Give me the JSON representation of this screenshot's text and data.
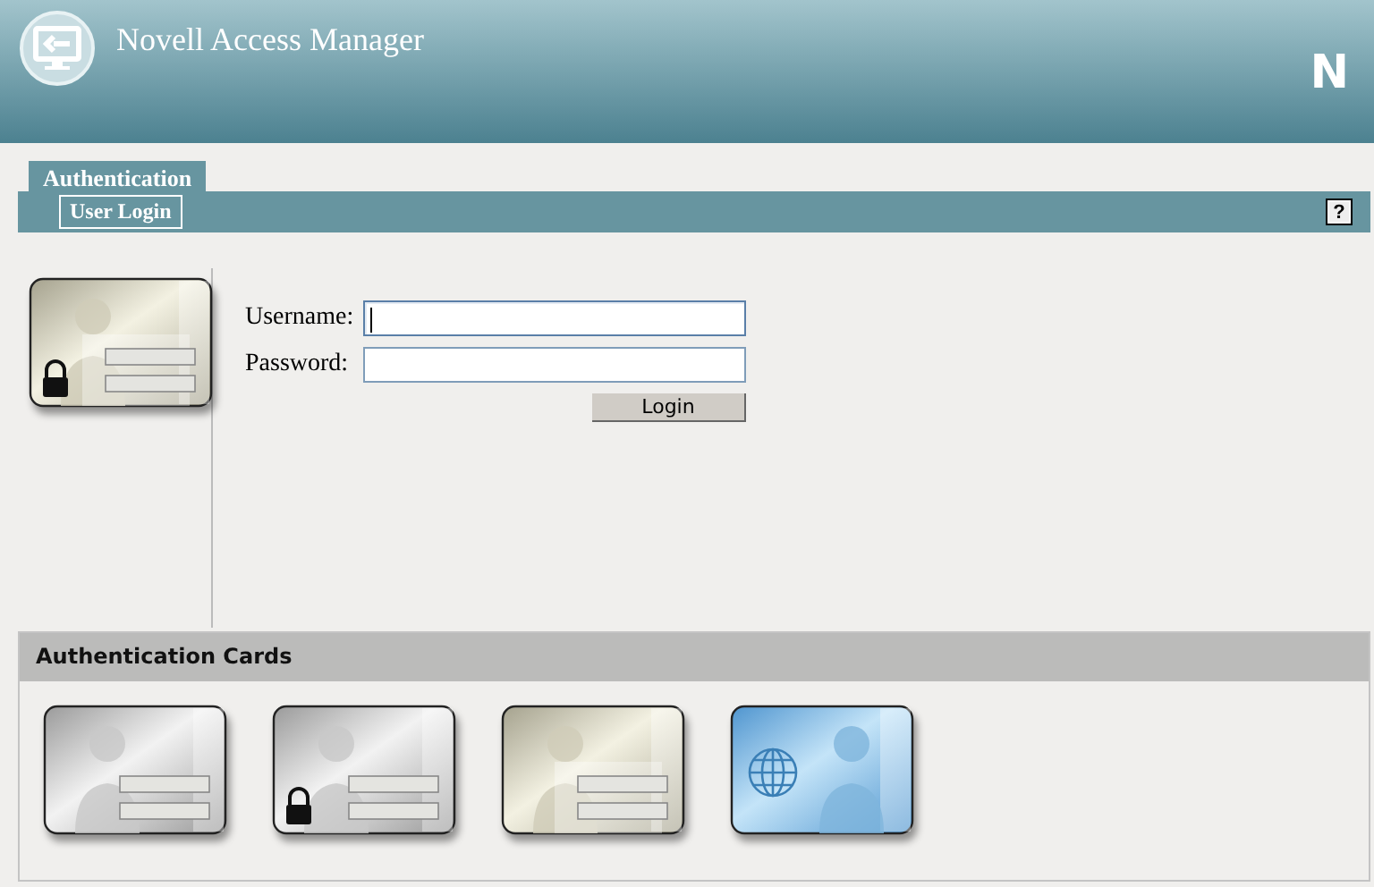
{
  "header": {
    "title": "Novell Access Manager",
    "logo": "N"
  },
  "tabs": [
    {
      "label": "Authentication",
      "selected": true
    }
  ],
  "subtabs": [
    {
      "label": "User Login",
      "selected": true
    }
  ],
  "help": "?",
  "login": {
    "card": {
      "kind": "form-lock"
    },
    "fields": [
      {
        "label": "Username:",
        "focused": true
      },
      {
        "label": "Password:",
        "focused": false
      }
    ],
    "button": "Login"
  },
  "cards_section": {
    "title": "Authentication Cards",
    "cards": [
      {
        "kind": "basic"
      },
      {
        "kind": "lock"
      },
      {
        "kind": "form"
      },
      {
        "kind": "globe"
      }
    ]
  }
}
